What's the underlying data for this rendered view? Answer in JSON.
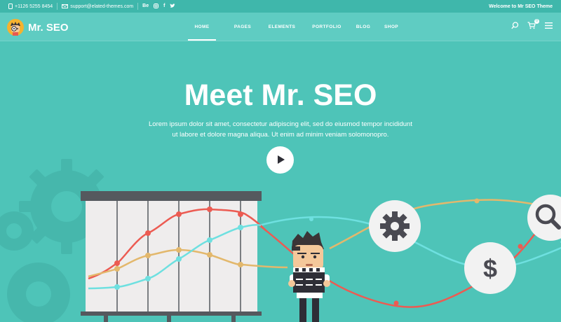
{
  "topbar": {
    "phone": "+1126 5255 8454",
    "email": "support@elated-themes.com",
    "social": [
      "Be",
      "IG",
      "f",
      "t"
    ],
    "welcome": "Welcome to Mr SEO Theme"
  },
  "brand": {
    "name": "Mr. SEO"
  },
  "nav": {
    "items": [
      "HOME",
      "PAGES",
      "ELEMENTS",
      "PORTFOLIO",
      "BLOG",
      "SHOP"
    ],
    "active": "HOME",
    "cart_count": "0"
  },
  "hero": {
    "title": "Meet Mr. SEO",
    "text_line1": "Lorem ipsum dolor sit amet, consectetur adipiscing elit, sed do eiusmod tempor incididunt",
    "text_line2": "ut labore et dolore magna aliqua. Ut enim ad minim veniam solomonopro."
  },
  "icons": {
    "phone": "phone-icon",
    "email": "envelope-icon",
    "search": "search-icon",
    "cart": "cart-icon",
    "menu": "hamburger-icon",
    "play": "play-icon",
    "gear": "gear-icon",
    "dollar": "dollar-icon",
    "magnifier": "magnifier-icon"
  },
  "colors": {
    "background": "#4ec4b8",
    "navbar": "#5fccc2",
    "topbar": "#3fb7ab",
    "line_red": "#ec5b52",
    "line_yellow": "#e3b86c",
    "line_cyan": "#6ee0e0"
  }
}
